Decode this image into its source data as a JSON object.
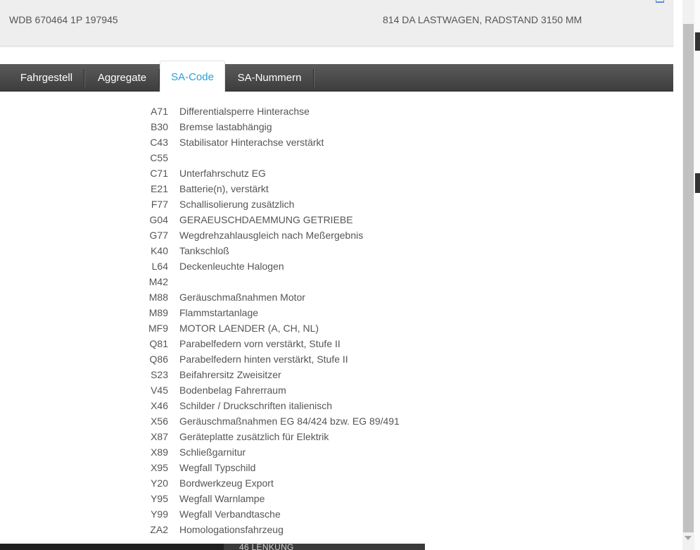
{
  "header": {
    "vin": "WDB 670464 1P 197945",
    "model": "814 DA LASTWAGEN, RADSTAND 3150 MM"
  },
  "tabs": [
    {
      "label": "Fahrgestell",
      "active": false
    },
    {
      "label": "Aggregate",
      "active": false
    },
    {
      "label": "SA-Code",
      "active": true
    },
    {
      "label": "SA-Nummern",
      "active": false
    }
  ],
  "codes": [
    {
      "code": "A71",
      "desc": "Differentialsperre Hinterachse"
    },
    {
      "code": "B30",
      "desc": "Bremse lastabhängig"
    },
    {
      "code": "C43",
      "desc": "Stabilisator Hinterachse verstärkt"
    },
    {
      "code": "C55",
      "desc": ""
    },
    {
      "code": "C71",
      "desc": "Unterfahrschutz EG"
    },
    {
      "code": "E21",
      "desc": "Batterie(n), verstärkt"
    },
    {
      "code": "F77",
      "desc": "Schallisolierung zusätzlich"
    },
    {
      "code": "G04",
      "desc": "GERAEUSCHDAEMMUNG GETRIEBE"
    },
    {
      "code": "G77",
      "desc": "Wegdrehzahlausgleich nach Meßergebnis"
    },
    {
      "code": "K40",
      "desc": "Tankschloß"
    },
    {
      "code": "L64",
      "desc": "Deckenleuchte Halogen"
    },
    {
      "code": "M42",
      "desc": ""
    },
    {
      "code": "M88",
      "desc": "Geräuschmaßnahmen Motor"
    },
    {
      "code": "M89",
      "desc": "Flammstartanlage"
    },
    {
      "code": "MF9",
      "desc": "MOTOR LAENDER (A, CH, NL)"
    },
    {
      "code": "Q81",
      "desc": "Parabelfedern vorn verstärkt, Stufe II"
    },
    {
      "code": "Q86",
      "desc": "Parabelfedern hinten verstärkt, Stufe II"
    },
    {
      "code": "S23",
      "desc": "Beifahrersitz Zweisitzer"
    },
    {
      "code": "V45",
      "desc": "Bodenbelag Fahrerraum"
    },
    {
      "code": "X46",
      "desc": "Schilder / Druckschriften italienisch"
    },
    {
      "code": "X56",
      "desc": "Geräuschmaßnahmen EG 84/424 bzw. EG 89/491"
    },
    {
      "code": "X87",
      "desc": "Geräteplatte zusätzlich für Elektrik"
    },
    {
      "code": "X89",
      "desc": "Schließgarnitur"
    },
    {
      "code": "X95",
      "desc": "Wegfall Typschild"
    },
    {
      "code": "Y20",
      "desc": "Bordwerkzeug Export"
    },
    {
      "code": "Y95",
      "desc": "Wegfall Warnlampe"
    },
    {
      "code": "Y99",
      "desc": "Wegfall Verbandtasche"
    },
    {
      "code": "ZA2",
      "desc": "Homologationsfahrzeug"
    }
  ],
  "background": {
    "bottom_text": "46 LENKUNG"
  },
  "colors": {
    "active_tab_text": "#2aa0d8",
    "tabbar_bg": "#4a4a4a",
    "header_bg": "#eeeeee"
  }
}
